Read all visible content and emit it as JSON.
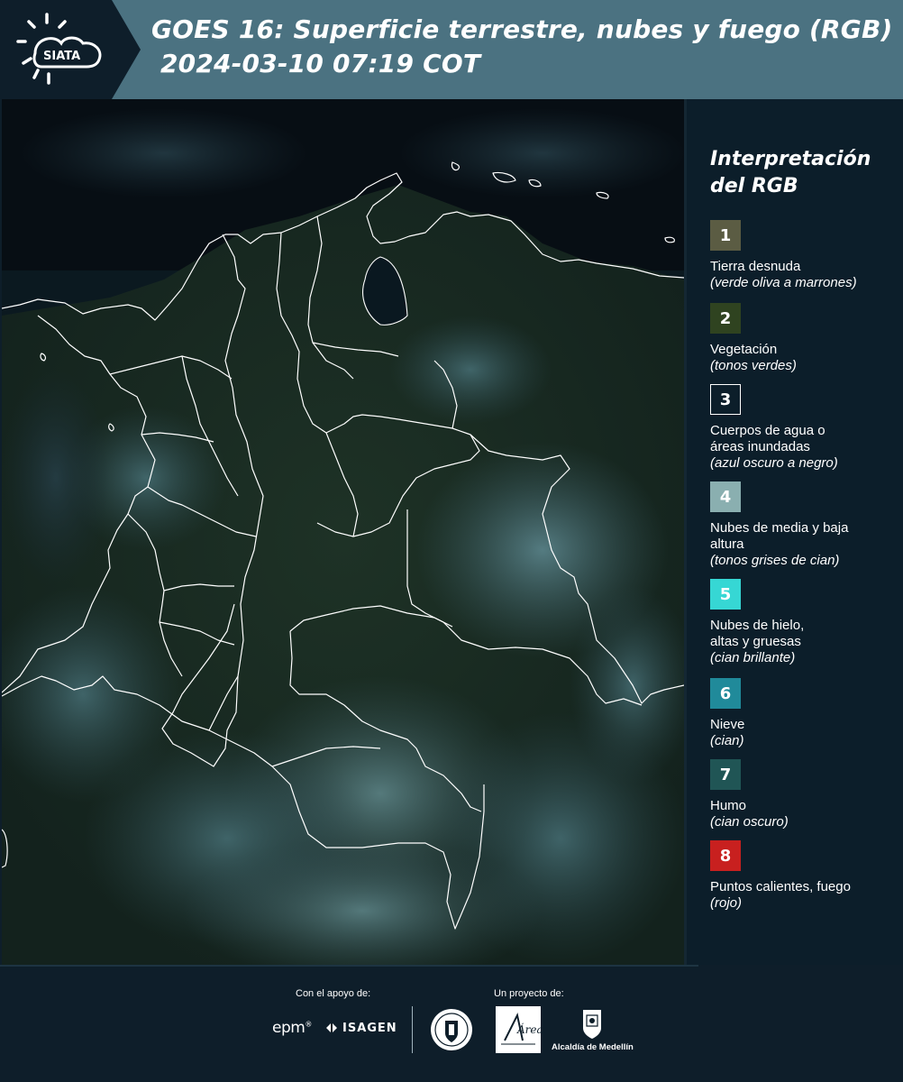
{
  "header": {
    "logo_text": "SIATA",
    "title_line1": "GOES 16: Superficie terrestre, nubes y fuego (RGB)",
    "title_line2": "2024-03-10 07:19 COT"
  },
  "legend": {
    "title": "Interpretación del RGB",
    "items": [
      {
        "number": "1",
        "label": "Tierra desnuda",
        "desc": "(verde oliva a marrones)",
        "color": "#5b5c43"
      },
      {
        "number": "2",
        "label": "Vegetación",
        "desc": "(tonos verdes)",
        "color": "#2f4320"
      },
      {
        "number": "3",
        "label": "Cuerpos de agua o áreas inundadas",
        "desc": "(azul oscuro a negro)",
        "color": "#0c1e2a"
      },
      {
        "number": "4",
        "label": "Nubes de media y baja altura",
        "desc": "(tonos grises de cian)",
        "color": "#8aafb0"
      },
      {
        "number": "5",
        "label": "Nubes de hielo, altas y gruesas",
        "desc": "(cian brillante)",
        "color": "#36d7d4"
      },
      {
        "number": "6",
        "label": "Nieve",
        "desc": "(cian)",
        "color": "#208a9a"
      },
      {
        "number": "7",
        "label": "Humo",
        "desc": "(cian oscuro)",
        "color": "#205555"
      },
      {
        "number": "8",
        "label": "Puntos calientes, fuego",
        "desc": "(rojo)",
        "color": "#c8201f"
      }
    ]
  },
  "footer": {
    "support_caption": "Con el apoyo de:",
    "project_caption": "Un proyecto de:",
    "epm_logo": "epm",
    "isagen_logo": "ISAGEN",
    "area_logo": "Área",
    "medellin_logo": "Alcaldía de Medellín"
  },
  "colors": {
    "header_bg": "#4b7281",
    "logo_bg": "#0e1e2a",
    "legend_bg": "#0c1e2a",
    "border_lines": "#ffffff"
  }
}
